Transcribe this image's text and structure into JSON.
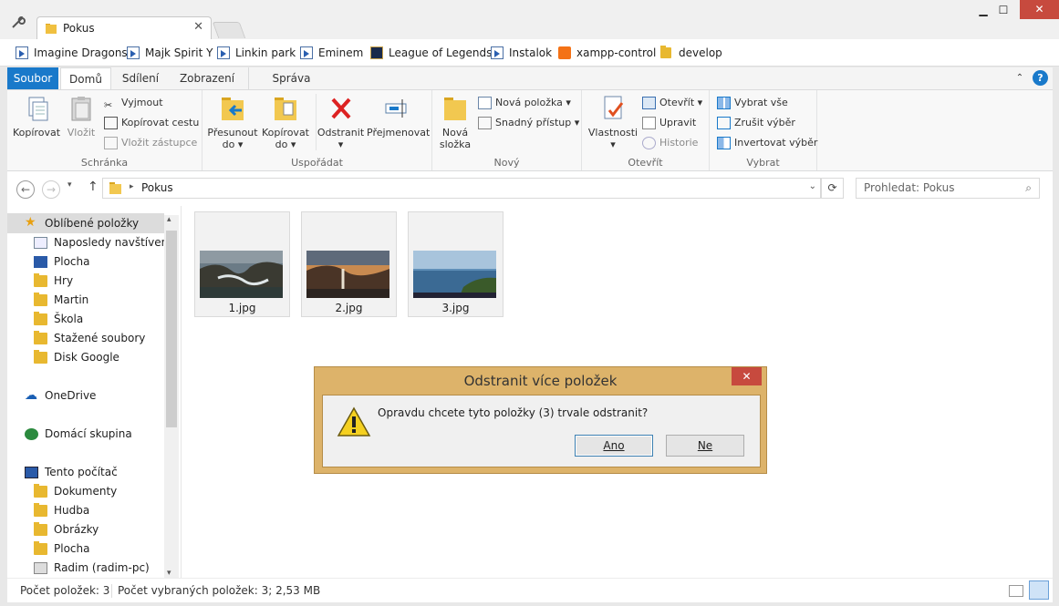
{
  "window": {
    "tab_title": "Pokus",
    "minimize": "▁",
    "maximize": "☐",
    "close": "✕"
  },
  "bookmarks": [
    {
      "label": "Imagine Dragons",
      "icon": "file-icon"
    },
    {
      "label": "Majk Spirit Y",
      "icon": "file-icon"
    },
    {
      "label": "Linkin park",
      "icon": "file-icon"
    },
    {
      "label": "Eminem",
      "icon": "file-icon"
    },
    {
      "label": "League of Legends",
      "icon": "game-icon"
    },
    {
      "label": "Instalok",
      "icon": "file-icon"
    },
    {
      "label": "xampp-control",
      "icon": "xampp-icon"
    },
    {
      "label": "develop",
      "icon": "folder-icon"
    }
  ],
  "ribbon_tabs": [
    "Soubor",
    "Domů",
    "Sdílení",
    "Zobrazení",
    "Správa"
  ],
  "ribbon": {
    "clipboard": {
      "copy": "Kopírovat",
      "paste": "Vložit",
      "cut": "Vyjmout",
      "copy_path": "Kopírovat cestu",
      "paste_shortcut": "Vložit zástupce",
      "group": "Schránka"
    },
    "organize": {
      "move_to_1": "Přesunout",
      "move_to_2": "do",
      "copy_to_1": "Kopírovat",
      "copy_to_2": "do",
      "delete": "Odstranit",
      "rename": "Přejmenovat",
      "group": "Uspořádat"
    },
    "new": {
      "new_folder_1": "Nová",
      "new_folder_2": "složka",
      "new_item": "Nová položka",
      "easy_access": "Snadný přístup",
      "group": "Nový"
    },
    "open": {
      "properties": "Vlastnosti",
      "open": "Otevřít",
      "edit": "Upravit",
      "history": "Historie",
      "group": "Otevřít"
    },
    "select": {
      "select_all": "Vybrat vše",
      "select_none": "Zrušit výběr",
      "invert": "Invertovat výběr",
      "group": "Vybrat"
    }
  },
  "address": {
    "path": "Pokus",
    "search_placeholder": "Prohledat: Pokus"
  },
  "nav": {
    "favorites": "Oblíbené položky",
    "fav_items": [
      "Naposledy navštívené",
      "Plocha",
      "Hry",
      "Martin",
      "Škola",
      "Stažené soubory",
      "Disk Google"
    ],
    "onedrive": "OneDrive",
    "homegroup": "Domácí skupina",
    "this_pc": "Tento počítač",
    "pc_items": [
      "Dokumenty",
      "Hudba",
      "Obrázky",
      "Plocha",
      "Radim (radim-pc)"
    ]
  },
  "files": [
    "1.jpg",
    "2.jpg",
    "3.jpg"
  ],
  "status": {
    "count": "Počet položek: 3",
    "selected": "Počet vybraných položek: 3; 2,53 MB"
  },
  "dialog": {
    "title": "Odstranit více položek",
    "message": "Opravdu chcete tyto položky (3) trvale odstranit?",
    "yes": "Ano",
    "no": "Ne"
  },
  "colors": {
    "accent": "#1979ca",
    "dialog_frame": "#ddb36a",
    "close_red": "#c74a3e"
  }
}
